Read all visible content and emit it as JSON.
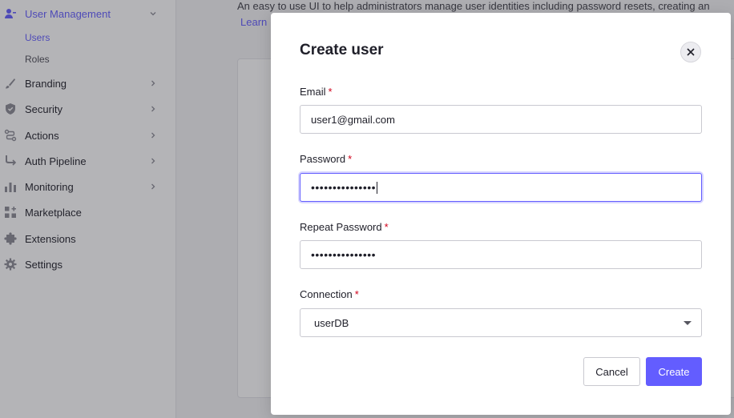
{
  "sidebar": {
    "section": {
      "label": "User Management",
      "icon": "users-icon"
    },
    "subitems": [
      {
        "label": "Users",
        "active": true
      },
      {
        "label": "Roles",
        "active": false
      }
    ],
    "items": [
      {
        "label": "Branding",
        "icon": "brush-icon"
      },
      {
        "label": "Security",
        "icon": "shield-icon"
      },
      {
        "label": "Actions",
        "icon": "flow-icon"
      },
      {
        "label": "Auth Pipeline",
        "icon": "pipeline-icon"
      },
      {
        "label": "Monitoring",
        "icon": "chart-icon"
      },
      {
        "label": "Marketplace",
        "icon": "grid-plus-icon"
      },
      {
        "label": "Extensions",
        "icon": "puzzle-icon"
      },
      {
        "label": "Settings",
        "icon": "gear-icon"
      }
    ]
  },
  "main": {
    "description": "An easy to use UI to help administrators manage user identities including password resets, creating an",
    "link": "Learn"
  },
  "modal": {
    "title": "Create user",
    "email": {
      "label": "Email",
      "required": "*",
      "value": "user1@gmail.com"
    },
    "password": {
      "label": "Password",
      "required": "*",
      "value": "•••••••••••••••"
    },
    "repeat_password": {
      "label": "Repeat Password",
      "required": "*",
      "value": "•••••••••••••••"
    },
    "connection": {
      "label": "Connection",
      "required": "*",
      "value": "userDB"
    },
    "cancel_label": "Cancel",
    "create_label": "Create"
  },
  "colors": {
    "accent": "#635dff",
    "required": "#d0021b"
  }
}
